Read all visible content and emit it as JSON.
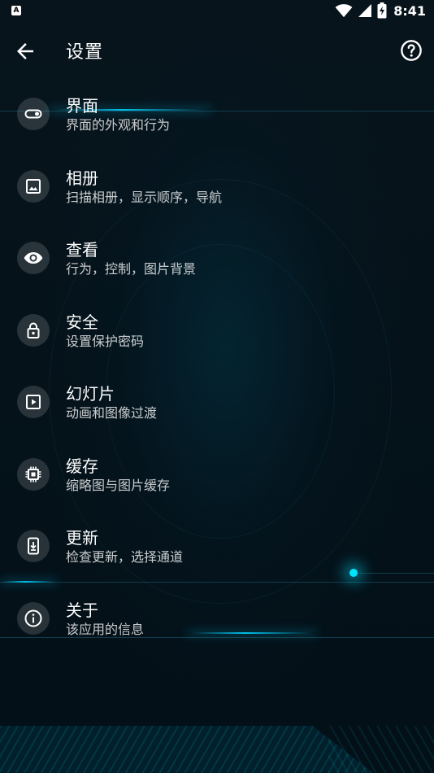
{
  "status_bar": {
    "notification_badge": "A",
    "time": "8:41"
  },
  "app_bar": {
    "title": "设置"
  },
  "settings": [
    {
      "title": "界面",
      "subtitle": "界面的外观和行为",
      "icon": "toggle-icon"
    },
    {
      "title": "相册",
      "subtitle": "扫描相册，显示顺序，导航",
      "icon": "image-icon"
    },
    {
      "title": "查看",
      "subtitle": "行为，控制，图片背景",
      "icon": "eye-icon"
    },
    {
      "title": "安全",
      "subtitle": "设置保护密码",
      "icon": "lock-icon"
    },
    {
      "title": "幻灯片",
      "subtitle": "动画和图像过渡",
      "icon": "slideshow-icon"
    },
    {
      "title": "缓存",
      "subtitle": "缩略图与图片缓存",
      "icon": "chip-icon"
    },
    {
      "title": "更新",
      "subtitle": "检查更新，选择通道",
      "icon": "phone-download-icon"
    },
    {
      "title": "关于",
      "subtitle": "该应用的信息",
      "icon": "info-icon"
    }
  ],
  "colors": {
    "background": "#05121a",
    "accent_glow": "#00e5ff",
    "text_primary": "#ffffff",
    "icon_circle": "rgba(255,255,255,0.14)"
  }
}
